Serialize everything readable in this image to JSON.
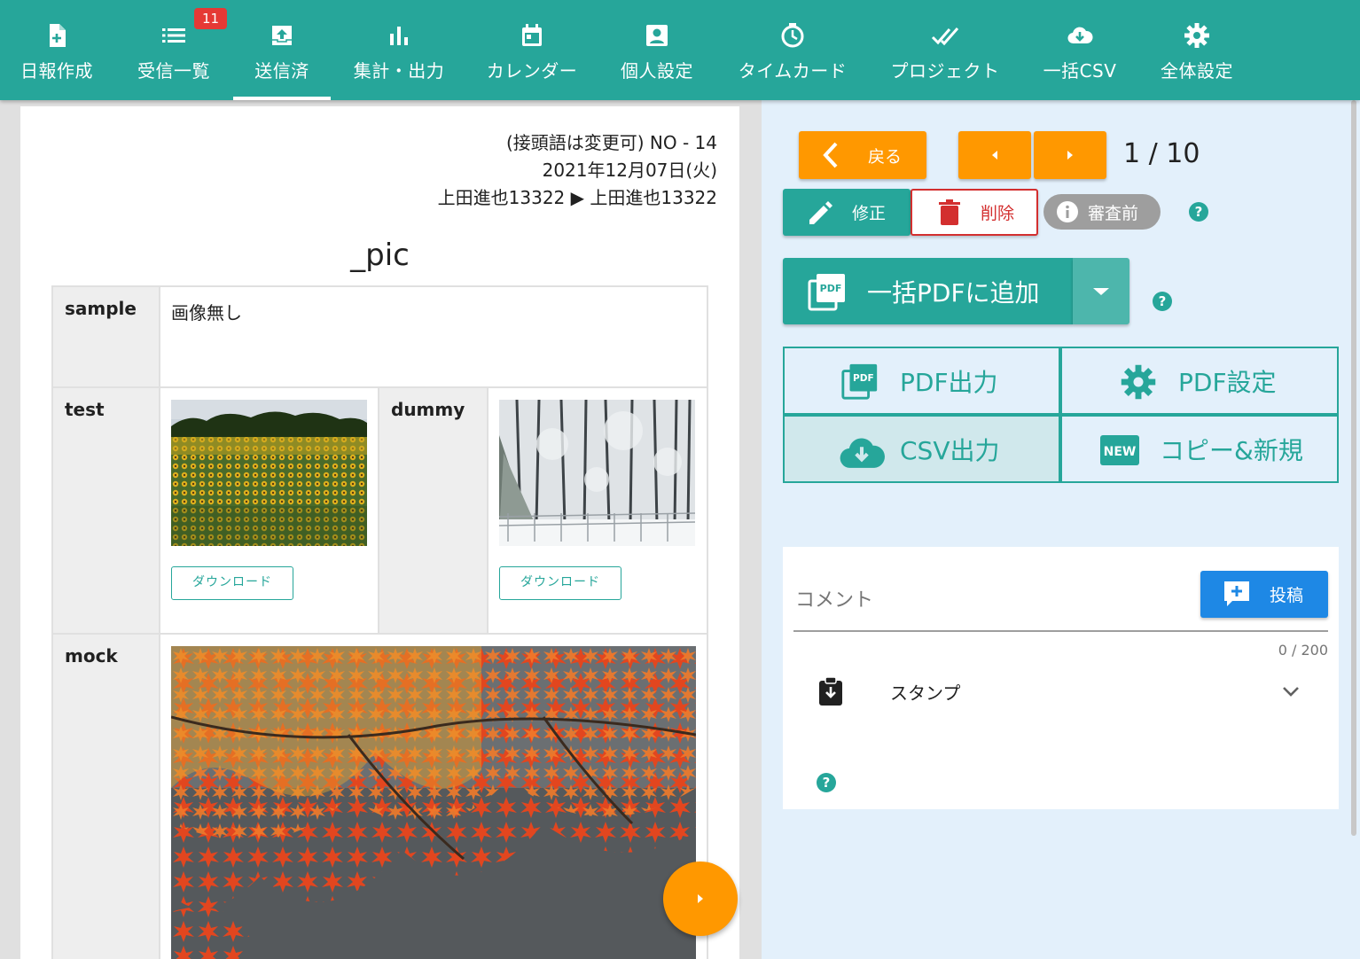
{
  "nav": {
    "items": [
      {
        "label": "日報作成",
        "icon": "file-plus-icon"
      },
      {
        "label": "受信一覧",
        "icon": "list-icon"
      },
      {
        "label": "送信済",
        "icon": "outbox-icon"
      },
      {
        "label": "集計・出力",
        "icon": "bar-chart-icon"
      },
      {
        "label": "カレンダー",
        "icon": "calendar-icon"
      },
      {
        "label": "個人設定",
        "icon": "user-card-icon"
      },
      {
        "label": "タイムカード",
        "icon": "timer-icon"
      },
      {
        "label": "プロジェクト",
        "icon": "check-double-icon"
      },
      {
        "label": "一括CSV",
        "icon": "cloud-download-icon"
      },
      {
        "label": "全体設定",
        "icon": "gear-icon"
      }
    ],
    "inbox_badge": "11",
    "active": "送信済"
  },
  "report": {
    "number_line": "(接頭語は変更可) NO - 14",
    "date": "2021年12月07日(火)",
    "route": "上田進也13322 ▶ 上田進也13322",
    "title": "_pic",
    "rows": {
      "sample": {
        "label": "sample",
        "value": "画像無し"
      },
      "test": {
        "label": "test",
        "download": "ダウンロード"
      },
      "dummy": {
        "label": "dummy",
        "download": "ダウンロード"
      },
      "mock": {
        "label": "mock"
      }
    }
  },
  "controls": {
    "back": "戻る",
    "pager": "1 / 10",
    "edit": "修正",
    "delete": "削除",
    "status": "審査前",
    "bulk_pdf": "一括PDFに追加",
    "pdf_output": "PDF出力",
    "pdf_settings": "PDF設定",
    "csv_output": "CSV出力",
    "copy_new": "コピー&新規",
    "help": "?"
  },
  "comment": {
    "placeholder": "コメント",
    "post": "投稿",
    "counter": "0 / 200",
    "stamp": "スタンプ"
  },
  "colors": {
    "teal": "#26a69a",
    "orange": "#ff9800",
    "red": "#d32f2f",
    "blue": "#1e88e5",
    "panel": "#e3f0fb"
  }
}
